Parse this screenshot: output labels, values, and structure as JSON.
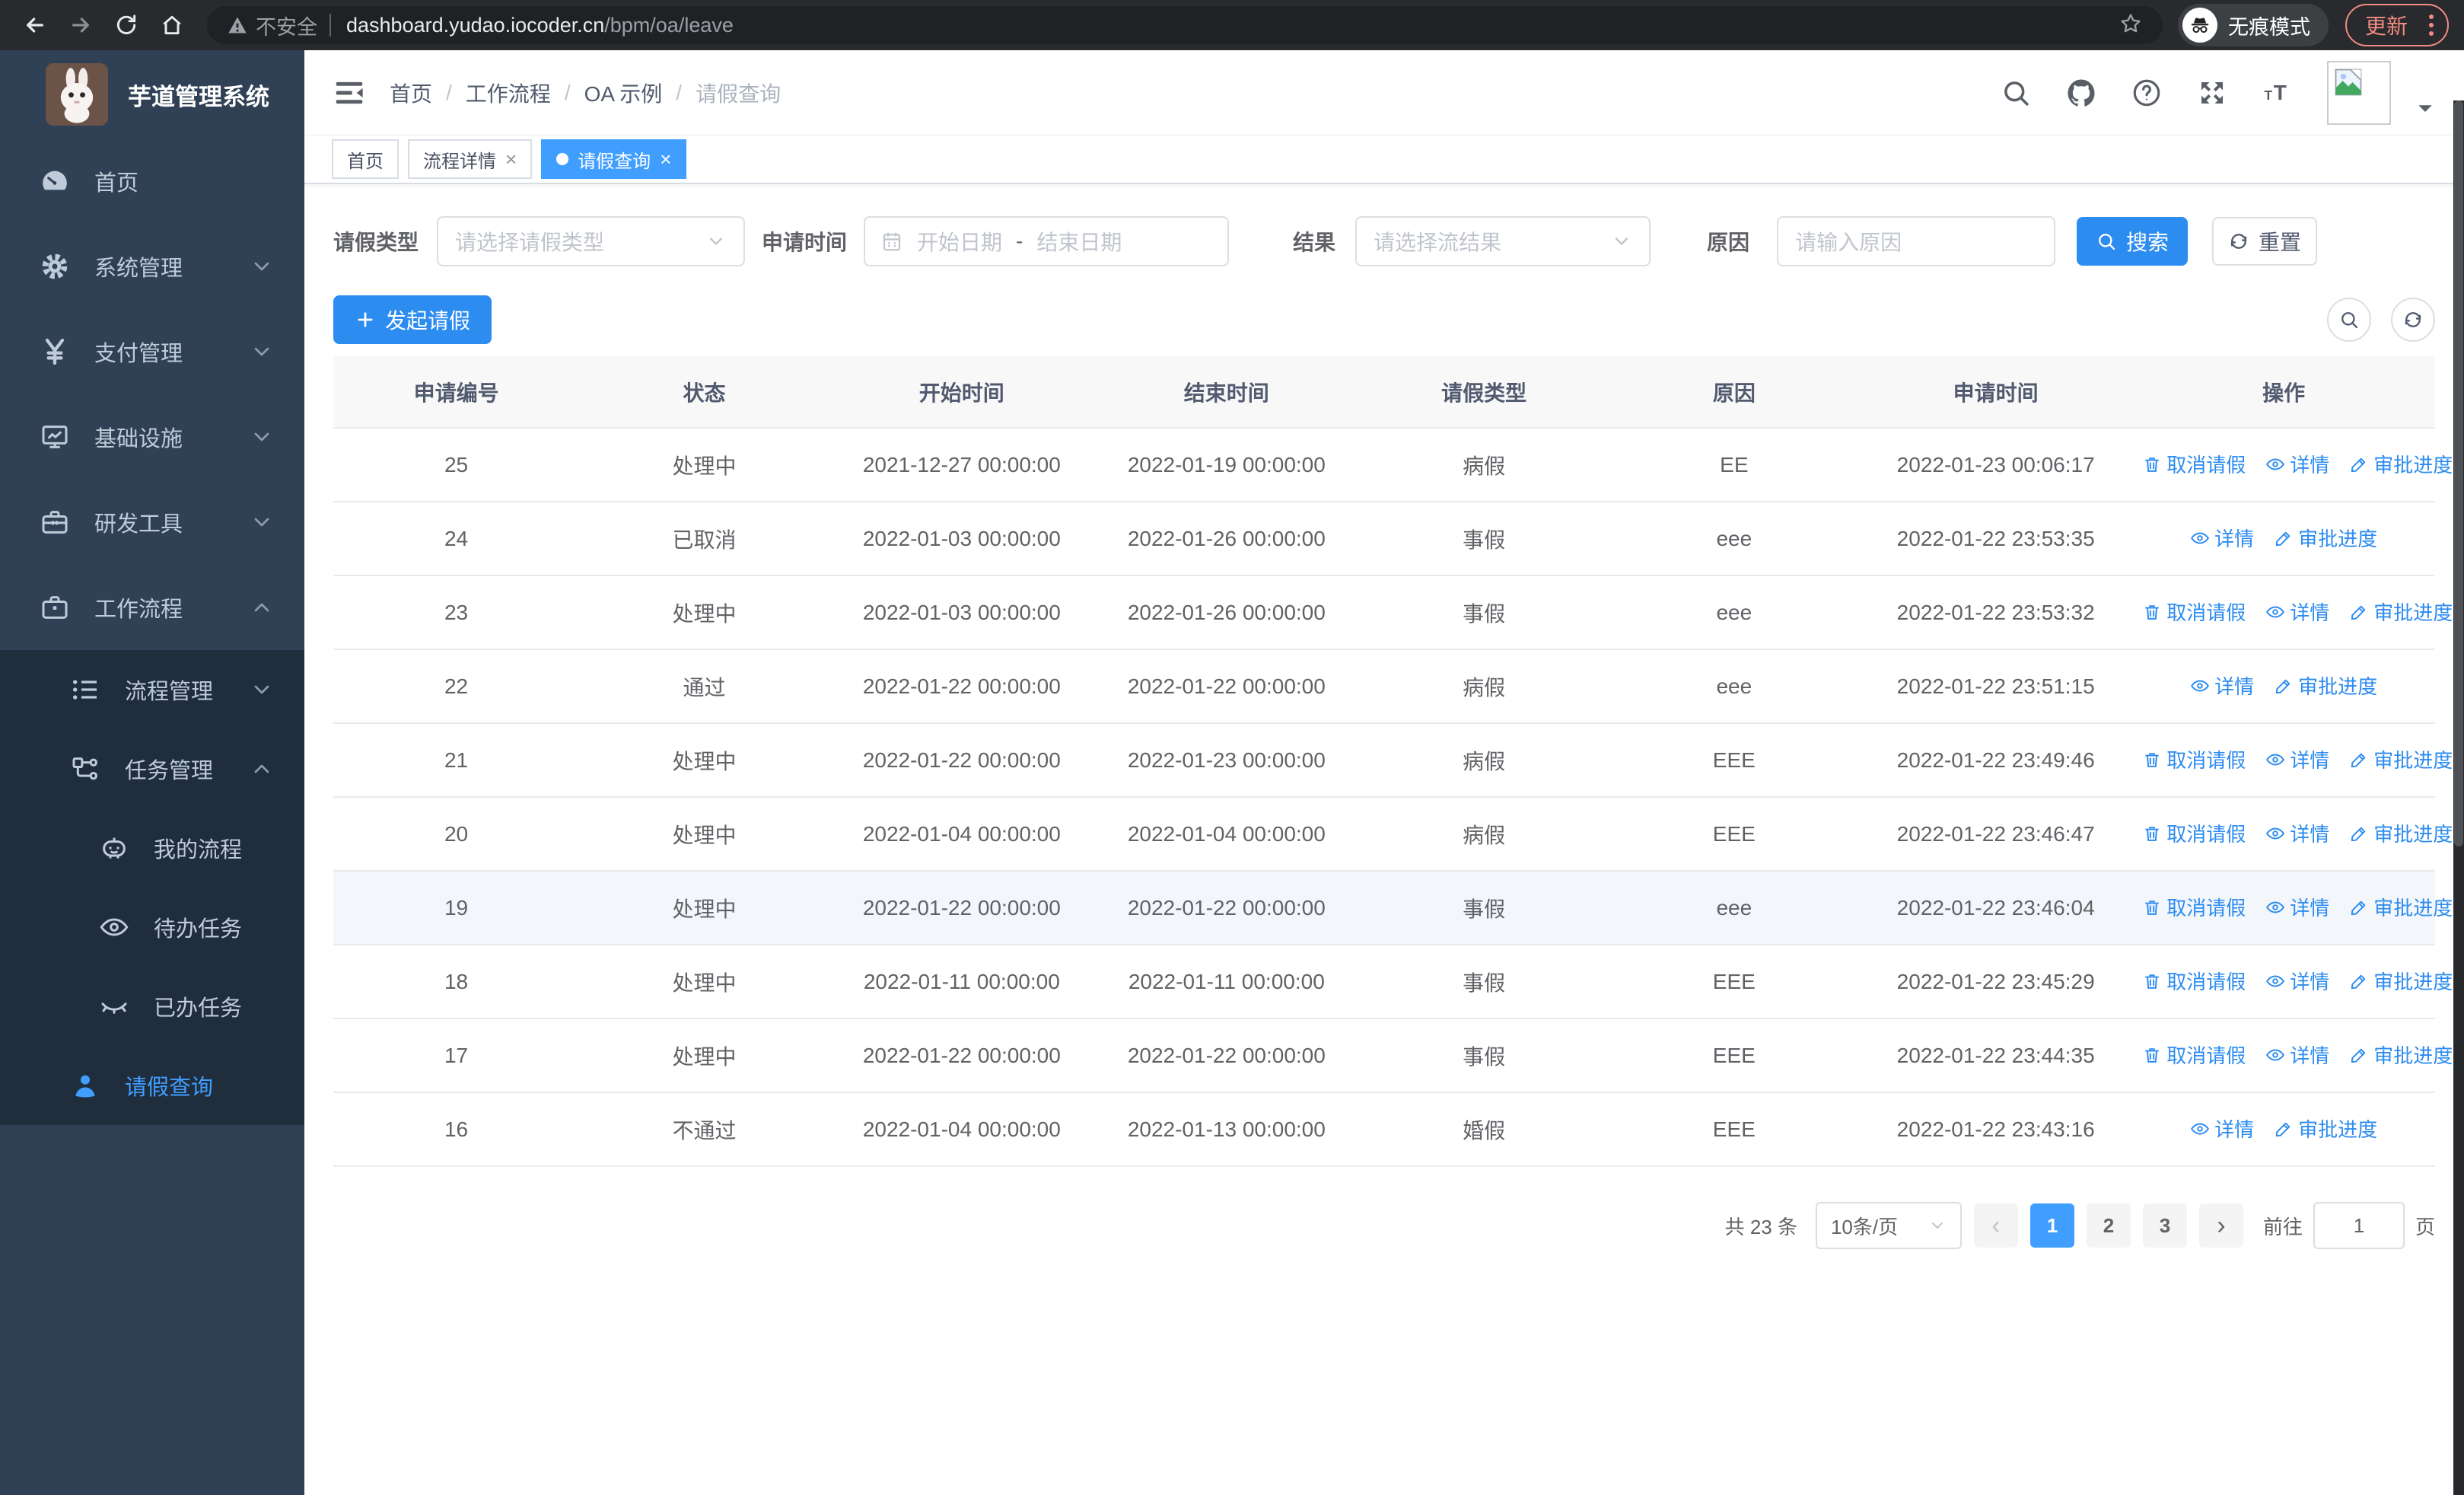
{
  "browser": {
    "not_secure": "不安全",
    "url_host": "dashboard.yudao.iocoder.cn",
    "url_path": "/bpm/oa/leave",
    "incognito": "无痕模式",
    "update": "更新"
  },
  "sidebar": {
    "title": "芋道管理系统",
    "menu": [
      {
        "label": "首页",
        "icon": "dashboard-icon",
        "level": 1,
        "chevron": null,
        "sub": false,
        "active": false
      },
      {
        "label": "系统管理",
        "icon": "gear-icon",
        "level": 1,
        "chevron": "down",
        "sub": false,
        "active": false
      },
      {
        "label": "支付管理",
        "icon": "yen-icon",
        "level": 1,
        "chevron": "down",
        "sub": false,
        "active": false
      },
      {
        "label": "基础设施",
        "icon": "monitor-icon",
        "level": 1,
        "chevron": "down",
        "sub": false,
        "active": false
      },
      {
        "label": "研发工具",
        "icon": "toolbox-icon",
        "level": 1,
        "chevron": "down",
        "sub": false,
        "active": false
      },
      {
        "label": "工作流程",
        "icon": "briefcase-icon",
        "level": 1,
        "chevron": "up",
        "sub": false,
        "active": false
      },
      {
        "label": "流程管理",
        "icon": "list-icon",
        "level": 2,
        "chevron": "down",
        "sub": true,
        "active": false
      },
      {
        "label": "任务管理",
        "icon": "flow-icon",
        "level": 2,
        "chevron": "up",
        "sub": true,
        "active": false
      },
      {
        "label": "我的流程",
        "icon": "robot-icon",
        "level": 3,
        "chevron": null,
        "sub": true,
        "active": false
      },
      {
        "label": "待办任务",
        "icon": "eye-icon",
        "level": 3,
        "chevron": null,
        "sub": true,
        "active": false
      },
      {
        "label": "已办任务",
        "icon": "eye-closed-icon",
        "level": 3,
        "chevron": null,
        "sub": true,
        "active": false
      },
      {
        "label": "请假查询",
        "icon": "user-icon",
        "level": 2,
        "chevron": null,
        "sub": true,
        "active": true
      }
    ]
  },
  "header": {
    "breadcrumb": [
      "首页",
      "工作流程",
      "OA 示例",
      "请假查询"
    ]
  },
  "tabs": [
    {
      "label": "首页",
      "closable": false,
      "active": false
    },
    {
      "label": "流程详情",
      "closable": true,
      "active": false
    },
    {
      "label": "请假查询",
      "closable": true,
      "active": true
    }
  ],
  "filters": {
    "leave_type_label": "请假类型",
    "leave_type_placeholder": "请选择请假类型",
    "apply_time_label": "申请时间",
    "start_date_placeholder": "开始日期",
    "range_separator": "-",
    "end_date_placeholder": "结束日期",
    "result_label": "结果",
    "result_placeholder": "请选择流结果",
    "reason_label": "原因",
    "reason_placeholder": "请输入原因",
    "search_label": "搜索",
    "reset_label": "重置"
  },
  "toolbar": {
    "create_label": "发起请假"
  },
  "table": {
    "columns": [
      "申请编号",
      "状态",
      "开始时间",
      "结束时间",
      "请假类型",
      "原因",
      "申请时间",
      "操作"
    ],
    "action_labels": {
      "cancel": "取消请假",
      "detail": "详情",
      "progress": "审批进度"
    },
    "rows": [
      {
        "id": "25",
        "status": "处理中",
        "start": "2021-12-27 00:00:00",
        "end": "2022-01-19 00:00:00",
        "type": "病假",
        "reason": "EE",
        "apply": "2022-01-23 00:06:17",
        "actions": [
          "cancel",
          "detail",
          "progress"
        ],
        "highlight": false
      },
      {
        "id": "24",
        "status": "已取消",
        "start": "2022-01-03 00:00:00",
        "end": "2022-01-26 00:00:00",
        "type": "事假",
        "reason": "eee",
        "apply": "2022-01-22 23:53:35",
        "actions": [
          "detail",
          "progress"
        ],
        "highlight": false
      },
      {
        "id": "23",
        "status": "处理中",
        "start": "2022-01-03 00:00:00",
        "end": "2022-01-26 00:00:00",
        "type": "事假",
        "reason": "eee",
        "apply": "2022-01-22 23:53:32",
        "actions": [
          "cancel",
          "detail",
          "progress"
        ],
        "highlight": false
      },
      {
        "id": "22",
        "status": "通过",
        "start": "2022-01-22 00:00:00",
        "end": "2022-01-22 00:00:00",
        "type": "病假",
        "reason": "eee",
        "apply": "2022-01-22 23:51:15",
        "actions": [
          "detail",
          "progress"
        ],
        "highlight": false
      },
      {
        "id": "21",
        "status": "处理中",
        "start": "2022-01-22 00:00:00",
        "end": "2022-01-23 00:00:00",
        "type": "病假",
        "reason": "EEE",
        "apply": "2022-01-22 23:49:46",
        "actions": [
          "cancel",
          "detail",
          "progress"
        ],
        "highlight": false
      },
      {
        "id": "20",
        "status": "处理中",
        "start": "2022-01-04 00:00:00",
        "end": "2022-01-04 00:00:00",
        "type": "病假",
        "reason": "EEE",
        "apply": "2022-01-22 23:46:47",
        "actions": [
          "cancel",
          "detail",
          "progress"
        ],
        "highlight": false
      },
      {
        "id": "19",
        "status": "处理中",
        "start": "2022-01-22 00:00:00",
        "end": "2022-01-22 00:00:00",
        "type": "事假",
        "reason": "eee",
        "apply": "2022-01-22 23:46:04",
        "actions": [
          "cancel",
          "detail",
          "progress"
        ],
        "highlight": true
      },
      {
        "id": "18",
        "status": "处理中",
        "start": "2022-01-11 00:00:00",
        "end": "2022-01-11 00:00:00",
        "type": "事假",
        "reason": "EEE",
        "apply": "2022-01-22 23:45:29",
        "actions": [
          "cancel",
          "detail",
          "progress"
        ],
        "highlight": false
      },
      {
        "id": "17",
        "status": "处理中",
        "start": "2022-01-22 00:00:00",
        "end": "2022-01-22 00:00:00",
        "type": "事假",
        "reason": "EEE",
        "apply": "2022-01-22 23:44:35",
        "actions": [
          "cancel",
          "detail",
          "progress"
        ],
        "highlight": false
      },
      {
        "id": "16",
        "status": "不通过",
        "start": "2022-01-04 00:00:00",
        "end": "2022-01-13 00:00:00",
        "type": "婚假",
        "reason": "EEE",
        "apply": "2022-01-22 23:43:16",
        "actions": [
          "detail",
          "progress"
        ],
        "highlight": false
      }
    ]
  },
  "pagination": {
    "total": "共 23 条",
    "page_size": "10条/页",
    "pages": [
      "1",
      "2",
      "3"
    ],
    "active_page": "1",
    "goto_label": "前往",
    "goto_value": "1",
    "unit_label": "页"
  },
  "colors": {
    "primary": "#409eff",
    "button_blue": "#2d8cf0",
    "sidebar_bg": "#304156",
    "submenu_bg": "#1f2d3d",
    "update_accent": "#f28b82"
  }
}
